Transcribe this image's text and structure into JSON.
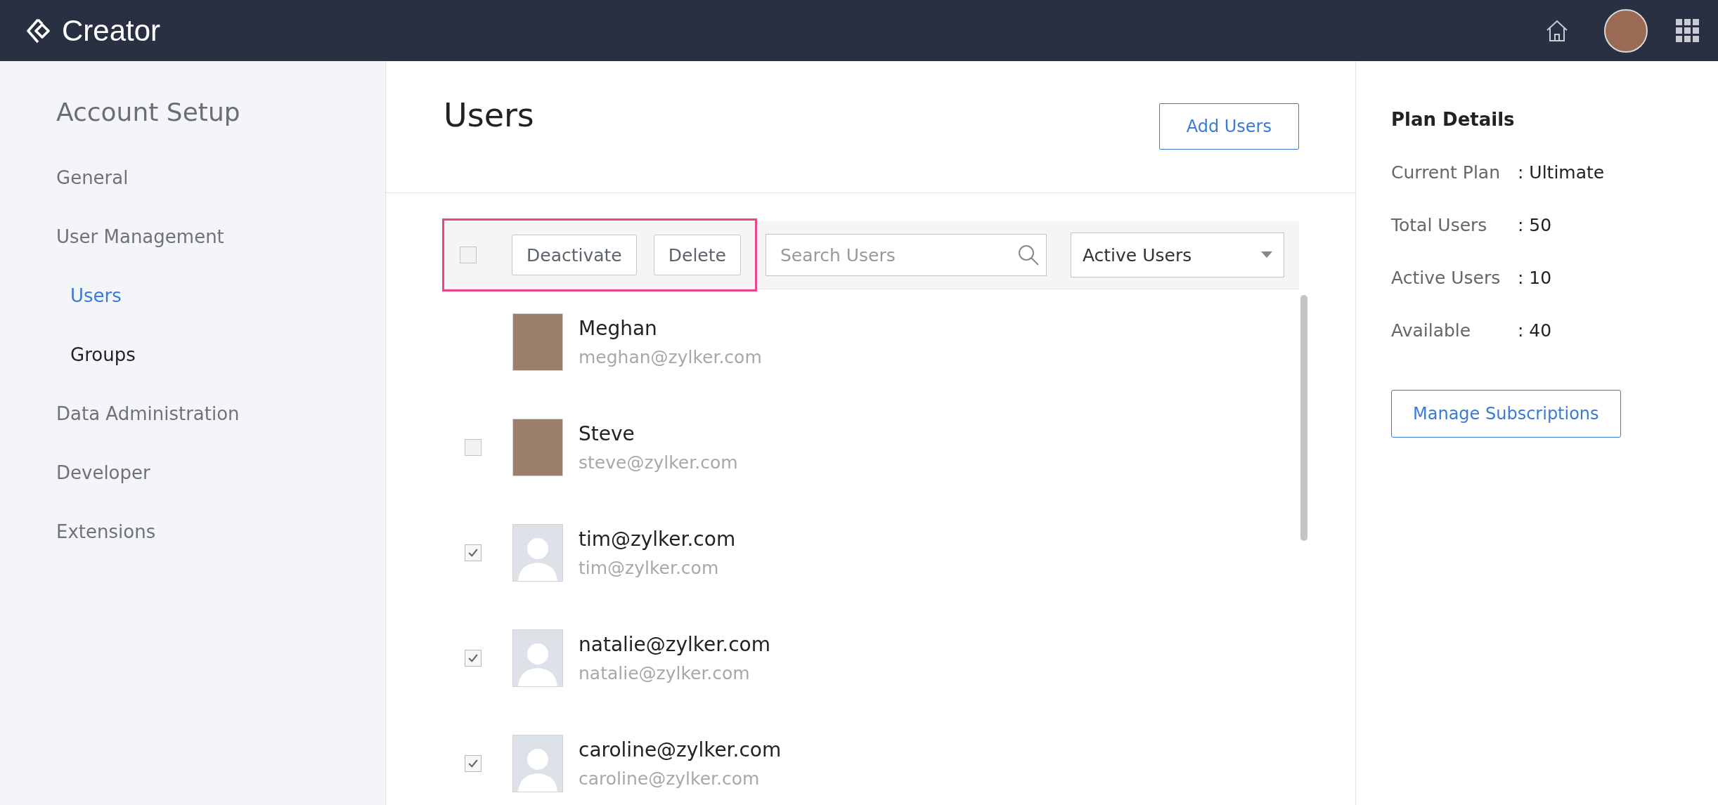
{
  "app": {
    "name": "Creator"
  },
  "sidebar": {
    "title": "Account Setup",
    "items": [
      {
        "label": "General",
        "kind": "section",
        "selected": false
      },
      {
        "label": "User Management",
        "kind": "section",
        "selected": false
      },
      {
        "label": "Users",
        "kind": "subitem",
        "selected": true
      },
      {
        "label": "Groups",
        "kind": "subitem",
        "selected": false
      },
      {
        "label": "Data Administration",
        "kind": "section",
        "selected": false
      },
      {
        "label": "Developer",
        "kind": "section",
        "selected": false
      },
      {
        "label": "Extensions",
        "kind": "section",
        "selected": false
      }
    ]
  },
  "main": {
    "title": "Users",
    "add_button": "Add Users",
    "toolbar": {
      "select_all": false,
      "actions": [
        "Deactivate",
        "Delete"
      ],
      "search": {
        "placeholder": "Search Users"
      },
      "filter": "Active Users"
    },
    "users": [
      {
        "name": "Meghan",
        "email": "meghan@zylker.com",
        "kind": "owner",
        "photo": true
      },
      {
        "name": "Steve",
        "email": "steve@zylker.com",
        "kind": "member",
        "photo": true,
        "checked": false
      },
      {
        "name": "tim@zylker.com",
        "email": "tim@zylker.com",
        "kind": "member",
        "photo": false,
        "checked": true
      },
      {
        "name": "natalie@zylker.com",
        "email": "natalie@zylker.com",
        "kind": "member",
        "photo": false,
        "checked": true
      },
      {
        "name": "caroline@zylker.com",
        "email": "caroline@zylker.com",
        "kind": "member",
        "photo": false,
        "checked": true
      }
    ]
  },
  "plan": {
    "title": "Plan Details",
    "rows": [
      {
        "label": "Current Plan",
        "value": ": Ultimate"
      },
      {
        "label": "Total Users",
        "value": ": 50"
      },
      {
        "label": "Active Users",
        "value": ": 10"
      },
      {
        "label": "Available",
        "value": ": 40"
      }
    ],
    "button": "Manage Subscriptions"
  }
}
